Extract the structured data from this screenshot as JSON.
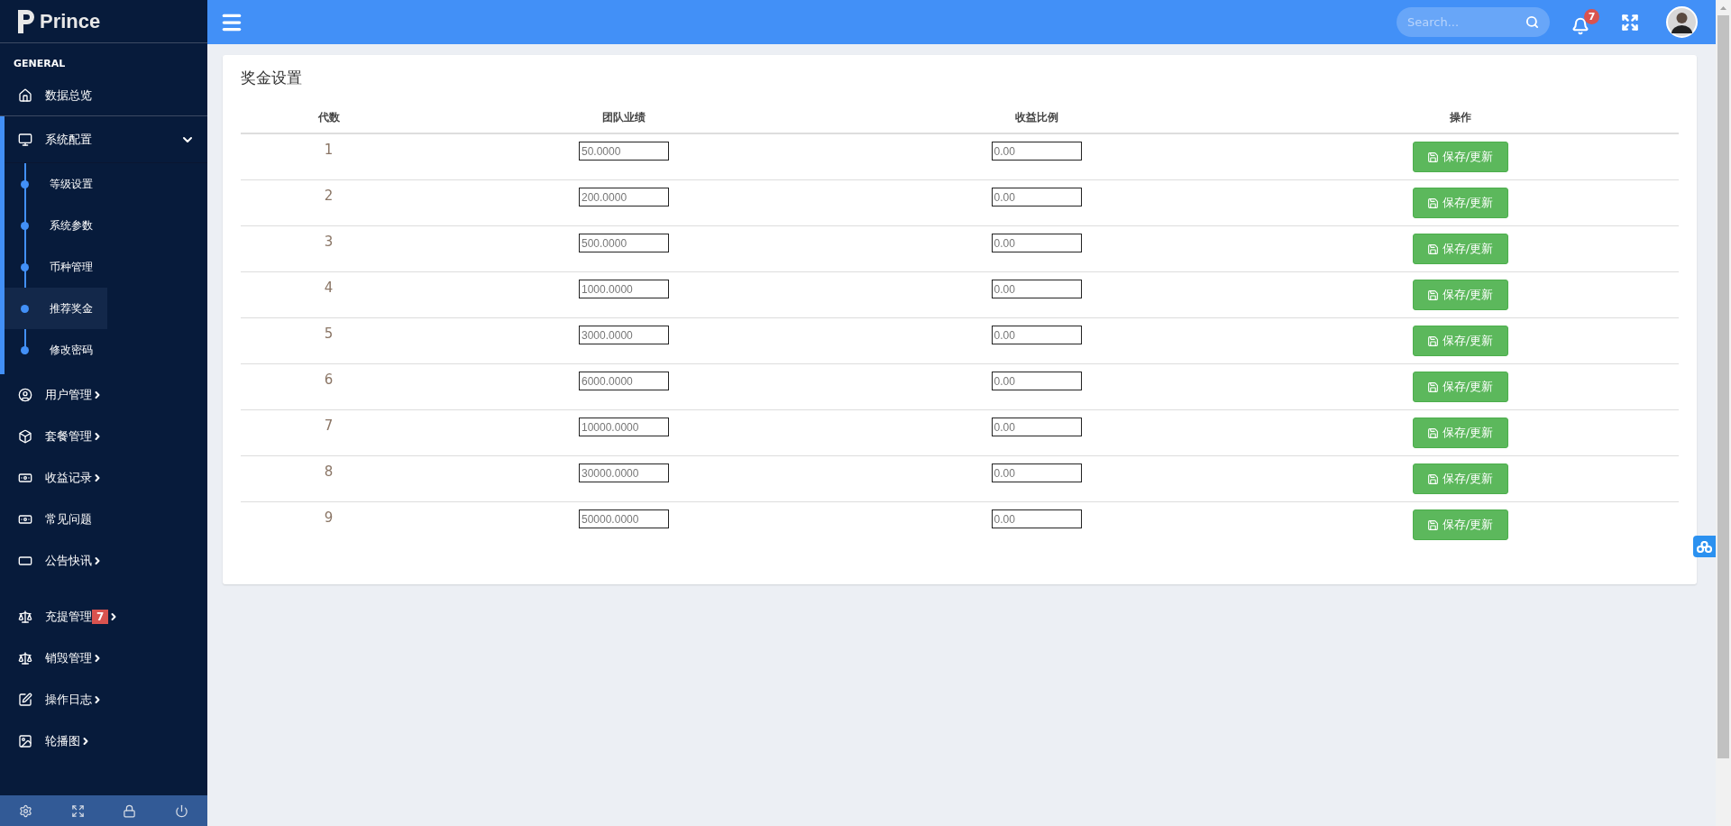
{
  "brand": {
    "name": "Prince"
  },
  "sidebar": {
    "section": "GENERAL",
    "items": [
      {
        "kind": "home",
        "label": "数据总览",
        "expandable": false
      },
      {
        "kind": "monitor",
        "label": "系统配置",
        "expandable": true,
        "expanded": true,
        "children": [
          {
            "label": "等级设置",
            "selected": false
          },
          {
            "label": "系统参数",
            "selected": false
          },
          {
            "label": "币种管理",
            "selected": false
          },
          {
            "label": "推荐奖金",
            "selected": true
          },
          {
            "label": "修改密码",
            "selected": false
          }
        ]
      },
      {
        "kind": "user",
        "label": "用户管理",
        "expandable": true,
        "expanded": false
      },
      {
        "kind": "cube",
        "label": "套餐管理",
        "expandable": true,
        "expanded": false
      },
      {
        "kind": "money",
        "label": "收益记录",
        "expandable": true,
        "expanded": false
      },
      {
        "kind": "money",
        "label": "常见问题",
        "expandable": false
      },
      {
        "kind": "window",
        "label": "公告快讯",
        "expandable": true,
        "expanded": false
      },
      {
        "kind": "scale",
        "label": "充提管理",
        "badge": "7",
        "expandable": true,
        "expanded": false
      },
      {
        "kind": "scale",
        "label": "销毁管理",
        "expandable": true,
        "expanded": false
      },
      {
        "kind": "edit",
        "label": "操作日志",
        "expandable": true,
        "expanded": false
      },
      {
        "kind": "image",
        "label": "轮播图",
        "expandable": true,
        "expanded": false
      }
    ],
    "footer": [
      {
        "kind": "settings"
      },
      {
        "kind": "expand"
      },
      {
        "kind": "lock"
      },
      {
        "kind": "power"
      }
    ]
  },
  "topbar": {
    "search": {
      "placeholder": "Search..."
    },
    "notifications": "7"
  },
  "panel": {
    "title": "奖金设置",
    "columns": [
      "代数",
      "团队业绩",
      "收益比例",
      "操作"
    ],
    "rows": [
      {
        "level": "1",
        "performance": "50.0000",
        "ratio": "0.00",
        "action": "保存/更新"
      },
      {
        "level": "2",
        "performance": "200.0000",
        "ratio": "0.00",
        "action": "保存/更新"
      },
      {
        "level": "3",
        "performance": "500.0000",
        "ratio": "0.00",
        "action": "保存/更新"
      },
      {
        "level": "4",
        "performance": "1000.0000",
        "ratio": "0.00",
        "action": "保存/更新"
      },
      {
        "level": "5",
        "performance": "3000.0000",
        "ratio": "0.00",
        "action": "保存/更新"
      },
      {
        "level": "6",
        "performance": "6000.0000",
        "ratio": "0.00",
        "action": "保存/更新"
      },
      {
        "level": "7",
        "performance": "10000.0000",
        "ratio": "0.00",
        "action": "保存/更新"
      },
      {
        "level": "8",
        "performance": "30000.0000",
        "ratio": "0.00",
        "action": "保存/更新"
      },
      {
        "level": "9",
        "performance": "50000.0000",
        "ratio": "0.00",
        "action": "保存/更新"
      }
    ]
  }
}
